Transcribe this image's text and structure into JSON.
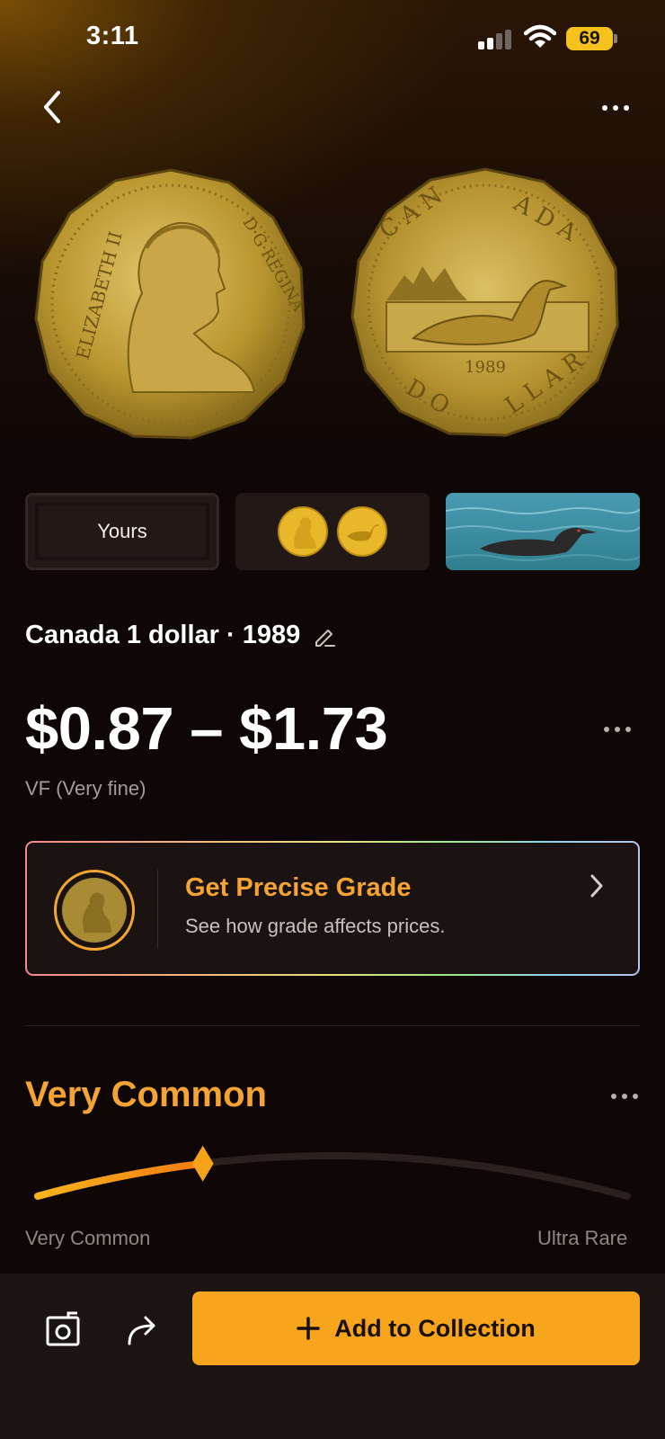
{
  "status_bar": {
    "time": "3:11",
    "battery": "69"
  },
  "thumbnails": {
    "yours_label": "Yours"
  },
  "coin": {
    "title": "Canada 1 dollar · 1989",
    "price_range": "$0.87 – $1.73",
    "grade": "VF (Very fine)"
  },
  "grade_card": {
    "title": "Get Precise Grade",
    "subtitle": "See how grade affects prices."
  },
  "rarity": {
    "title": "Very Common",
    "scale_low": "Very Common",
    "scale_high": "Ultra Rare",
    "level": 0.28
  },
  "bottom_bar": {
    "add_label": "Add to Collection"
  },
  "colors": {
    "accent": "#f5a332",
    "button": "#f8a51e",
    "background": "#0e0706"
  }
}
